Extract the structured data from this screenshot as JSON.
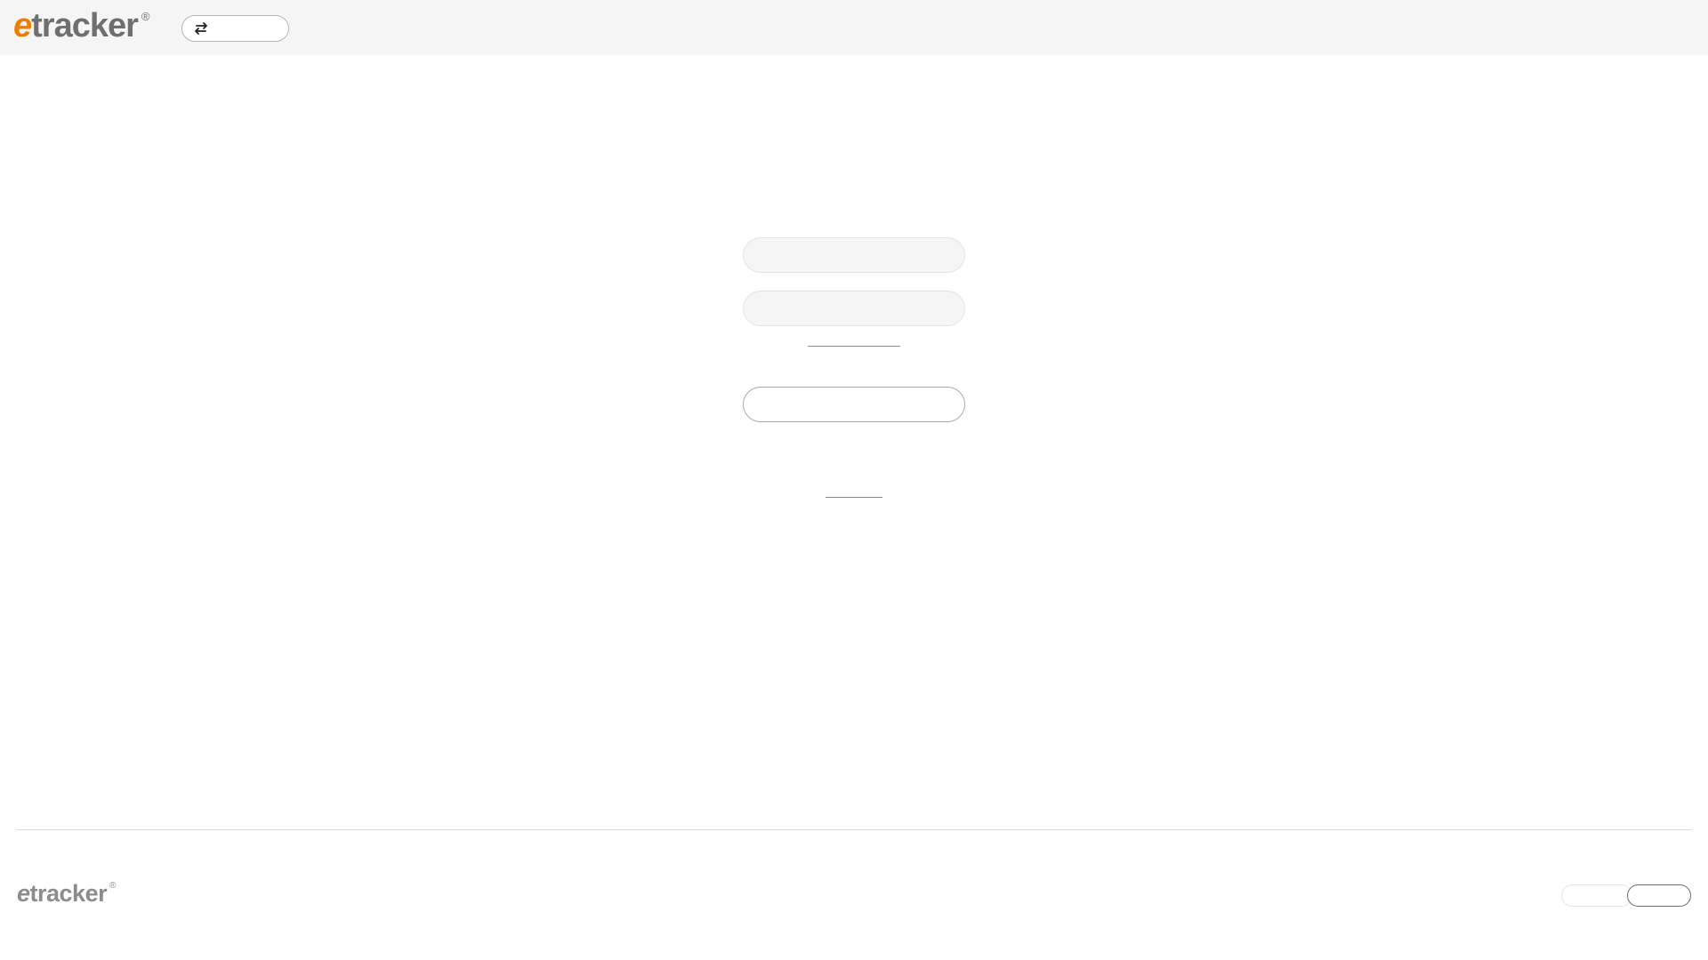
{
  "header": {
    "logo": {
      "e": "e",
      "rest": "tracker",
      "reg": "®"
    },
    "switch_label": ""
  },
  "login": {
    "username_placeholder": "",
    "password_placeholder": "",
    "forgot_label": "",
    "submit_label": "",
    "secondary_link_label": ""
  },
  "footer": {
    "logo": {
      "e": "e",
      "rest": "tracker",
      "reg": "®"
    },
    "lang_a": "",
    "lang_b": ""
  },
  "colors": {
    "brand_orange": "#f07d00",
    "logo_gray": "#6f6f6f",
    "header_bg": "#f5f5f5"
  }
}
